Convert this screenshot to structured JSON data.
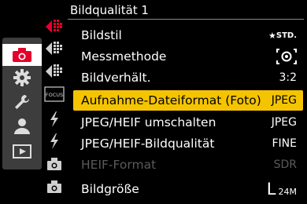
{
  "header": {
    "title": "Bildqualität 1"
  },
  "main_categories": [
    {
      "icon": "camera-icon",
      "active": true
    },
    {
      "icon": "gear-icon",
      "active": false
    },
    {
      "icon": "wrench-icon",
      "active": false
    },
    {
      "icon": "person-icon",
      "active": false
    },
    {
      "icon": "playback-icon",
      "active": false
    }
  ],
  "sub_tabs": [
    {
      "icon": "subtab-1-icon",
      "active": true
    },
    {
      "icon": "subtab-2-icon",
      "active": false
    },
    {
      "icon": "subtab-3-icon",
      "active": false
    },
    {
      "icon": "focus-icon",
      "label": "FOCUS",
      "active": false
    },
    {
      "icon": "flash-icon",
      "active": false
    },
    {
      "icon": "flash-icon",
      "active": false
    },
    {
      "icon": "camera-small-icon",
      "active": false
    },
    {
      "icon": "camera-small-icon",
      "active": false
    }
  ],
  "menu": {
    "items": [
      {
        "label": "Bildstil",
        "value": "STD.",
        "value_icon": "star-icon",
        "state": "normal"
      },
      {
        "label": "Messmethode",
        "value": "",
        "value_icon": "metering-icon",
        "state": "normal"
      },
      {
        "label": "Bildverhält.",
        "value": "3:2",
        "state": "normal"
      },
      {
        "label": "Aufnahme-Dateiformat (Foto)",
        "value": "JPEG",
        "state": "selected"
      },
      {
        "label": "JPEG/HEIF umschalten",
        "value": "JPEG",
        "state": "normal"
      },
      {
        "label": "JPEG/HEIF-Bildqualität",
        "value": "FINE",
        "state": "normal"
      },
      {
        "label": "HEIF-Format",
        "value": "SDR",
        "state": "disabled"
      },
      {
        "label": "Bildgröße",
        "value_l": "L",
        "value_size": "24M",
        "state": "normal"
      }
    ]
  },
  "colors": {
    "accent": "#f5c400",
    "sidebar_bg": "#3d3d3d",
    "active_icon": "#e4002b",
    "background": "#000000",
    "disabled_text": "#5a5a5a"
  }
}
